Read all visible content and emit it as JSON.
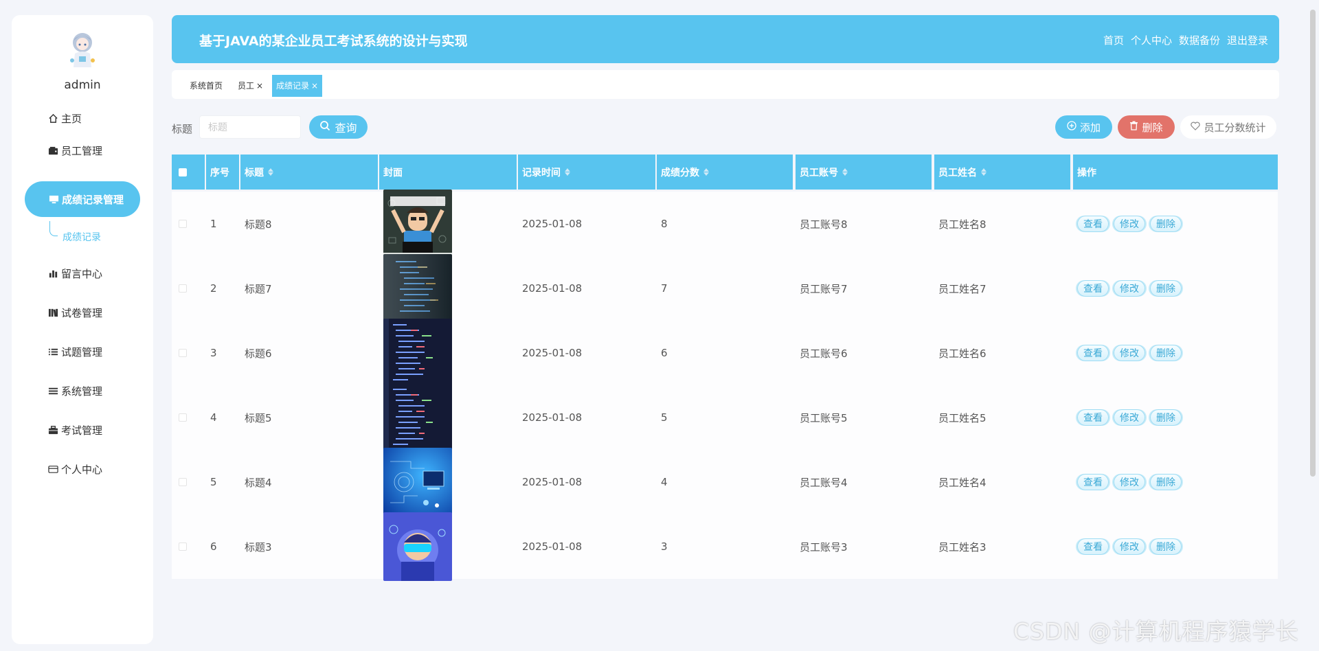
{
  "user": {
    "name": "admin"
  },
  "sidebar": {
    "items": [
      {
        "label": "主页",
        "icon": "home-icon"
      },
      {
        "label": "员工管理",
        "icon": "wallet-icon"
      },
      {
        "label": "成绩记录管理",
        "icon": "monitor-icon",
        "active": true
      },
      {
        "label": "留言中心",
        "icon": "bar-chart-icon"
      },
      {
        "label": "试卷管理",
        "icon": "books-icon"
      },
      {
        "label": "试题管理",
        "icon": "list-icon"
      },
      {
        "label": "系统管理",
        "icon": "menu-icon"
      },
      {
        "label": "考试管理",
        "icon": "briefcase-icon"
      },
      {
        "label": "个人中心",
        "icon": "card-icon"
      }
    ],
    "submenu": {
      "label": "成绩记录"
    }
  },
  "header": {
    "title": "基于JAVA的某企业员工考试系统的设计与实现",
    "nav": [
      "首页",
      "个人中心",
      "数据备份",
      "退出登录"
    ]
  },
  "tabs": [
    {
      "label": "系统首页"
    },
    {
      "label": "员工",
      "close": "×"
    },
    {
      "label": "成绩记录",
      "close": "×",
      "active": true
    }
  ],
  "search": {
    "label": "标题",
    "placeholder": "标题",
    "button": "查询"
  },
  "actions": {
    "add": "添加",
    "delete": "删除",
    "stats": "员工分数统计"
  },
  "table": {
    "columns": [
      "序号",
      "标题",
      "封面",
      "记录时间",
      "成绩分数",
      "员工账号",
      "员工姓名",
      "操作"
    ],
    "op_labels": [
      "查看",
      "修改",
      "删除"
    ],
    "rows": [
      {
        "index": "1",
        "title": "标题8",
        "time": "2025-01-08",
        "score": "8",
        "account": "员工账号8",
        "name": "员工姓名8",
        "cover": "cartoon-programmer"
      },
      {
        "index": "2",
        "title": "标题7",
        "time": "2025-01-08",
        "score": "7",
        "account": "员工账号7",
        "name": "员工姓名7",
        "cover": "code-screen"
      },
      {
        "index": "3",
        "title": "标题6",
        "time": "2025-01-08",
        "score": "6",
        "account": "员工账号6",
        "name": "员工姓名6",
        "cover": "code-dark"
      },
      {
        "index": "4",
        "title": "标题5",
        "time": "2025-01-08",
        "score": "5",
        "account": "员工账号5",
        "name": "员工姓名5",
        "cover": "code-dark"
      },
      {
        "index": "5",
        "title": "标题4",
        "time": "2025-01-08",
        "score": "4",
        "account": "员工账号4",
        "name": "员工姓名4",
        "cover": "tech-blue"
      },
      {
        "index": "6",
        "title": "标题3",
        "time": "2025-01-08",
        "score": "3",
        "account": "员工账号3",
        "name": "员工姓名3",
        "cover": "vr-cartoon"
      }
    ]
  },
  "watermark": "CSDN @计算机程序猿学长",
  "colors": {
    "primary": "#58c4ef",
    "danger": "#e2736a"
  }
}
